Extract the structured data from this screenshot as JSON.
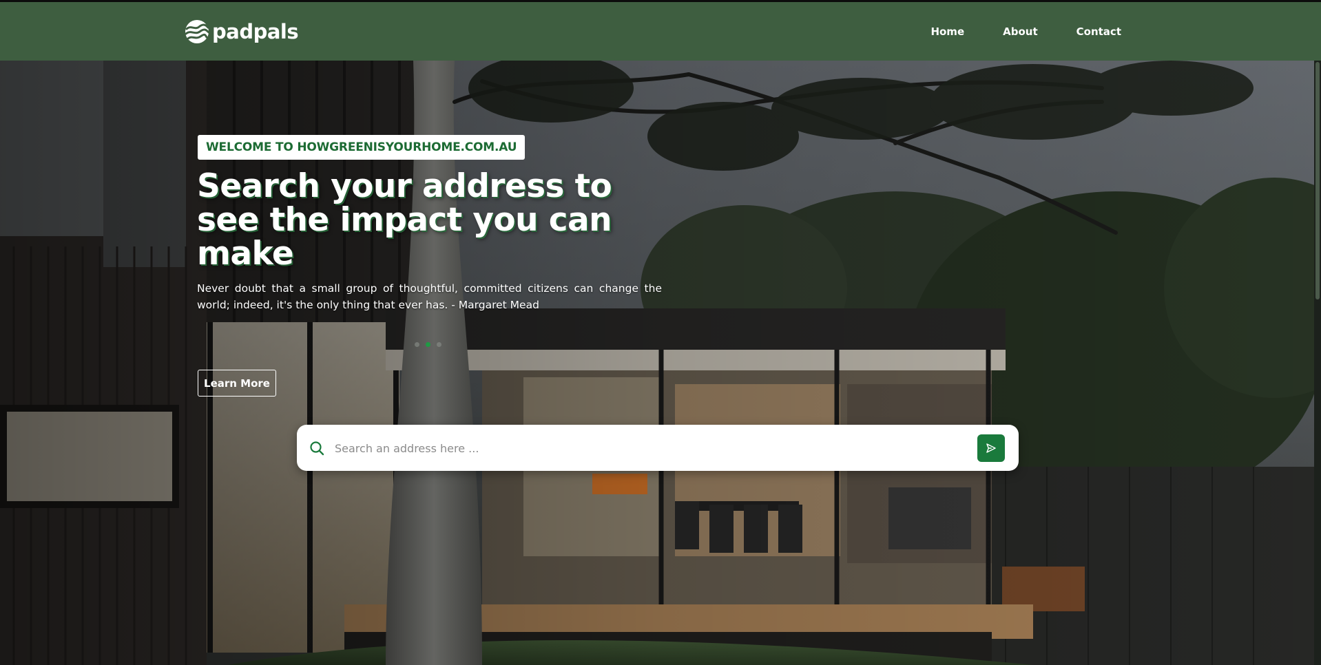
{
  "header": {
    "logo_text": "padpals",
    "logo_icon": "padpals-wave-logo",
    "nav": [
      {
        "label": "Home"
      },
      {
        "label": "About"
      },
      {
        "label": "Contact"
      }
    ],
    "background": "#3e5e40"
  },
  "hero": {
    "badge": "WELCOME TO HOWGREENISYOURHOME.COM.AU",
    "title": "Search your address to see the impact you can make",
    "quote": "Never doubt that a small group of thoughtful, committed citizens can change the world; indeed, it's the only thing that ever has. - Margaret Mead",
    "carousel": {
      "count": 3,
      "active_index": 1
    },
    "cta_label": "Learn More",
    "background_image": "modern-house-with-tree-at-dusk"
  },
  "search": {
    "placeholder": "Search an address here ...",
    "value": "",
    "search_icon": "search-icon",
    "submit_icon": "send-icon"
  },
  "colors": {
    "accent_green": "#1a7a3c",
    "badge_text": "#1c6b33"
  }
}
